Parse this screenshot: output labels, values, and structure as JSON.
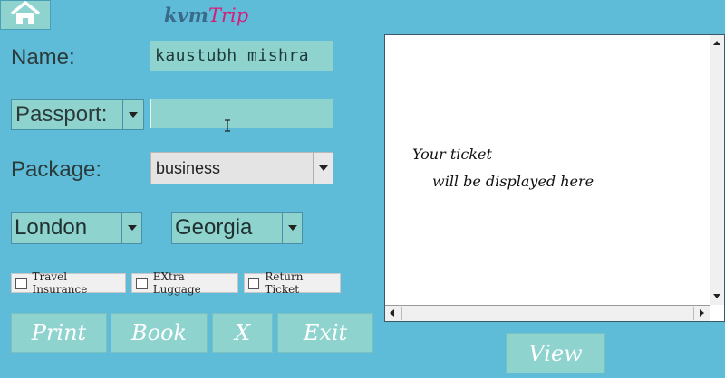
{
  "header": {
    "home_icon": "home-icon",
    "brand_part1": "kvm",
    "brand_part2": "Trip",
    "brand_color1": "#3a6a8a",
    "brand_color2": "#d81b7a"
  },
  "form": {
    "name_label": "Name:",
    "name_value": "kaustubh mishra",
    "passport_select": "Passport:",
    "passport_value": "",
    "package_label": "Package:",
    "package_value": "business",
    "from_city": "London",
    "to_city": "Georgia",
    "options": [
      {
        "label": "Travel Insurance",
        "checked": false
      },
      {
        "label": "EXtra Luggage",
        "checked": false
      },
      {
        "label": "Return Ticket",
        "checked": false
      }
    ]
  },
  "actions": {
    "print": "Print",
    "book": "Book",
    "clear": "X",
    "exit": "Exit",
    "view": "View"
  },
  "ticket": {
    "line1": "Your ticket",
    "line2": "will be displayed here"
  },
  "colors": {
    "background": "#5fbcd9",
    "control": "#8fd3cf"
  }
}
